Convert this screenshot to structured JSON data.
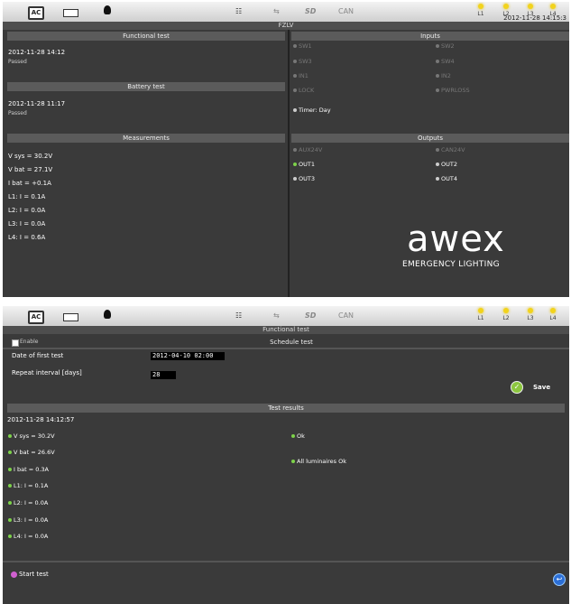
{
  "status": {
    "ac": "AC",
    "can": "CAN",
    "lamps": [
      "L1",
      "L2",
      "L3",
      "L4"
    ]
  },
  "screen1": {
    "title": "FZLV",
    "datetime": "2012-11-28 14:15:3",
    "functional_header": "Functional test",
    "functional_date": "2012-11-28 14:12",
    "functional_result": "Passed",
    "battery_header": "Battery test",
    "battery_date": "2012-11-28 11:17",
    "battery_result": "Passed",
    "meas_header": "Measurements",
    "measurements": [
      "V sys = 30.2V",
      "V bat = 27.1V",
      "I bat = +0.1A",
      "L1: I = 0.1A",
      "L2: I = 0.0A",
      "L3: I = 0.0A",
      "L4: I = 0.6A"
    ],
    "inputs_header": "Inputs",
    "inputs": [
      "SW1",
      "SW2",
      "SW3",
      "SW4",
      "IN1",
      "IN2",
      "LOCK",
      "PWRLOSS"
    ],
    "timer": "Timer: Day",
    "outputs_header": "Outputs",
    "outputs": [
      "AUX24V",
      "CAN24V",
      "OUT1",
      "OUT2",
      "OUT3",
      "OUT4"
    ],
    "logo": "awex",
    "logo_sub": "EMERGENCY LIGHTING"
  },
  "screen2": {
    "title": "Functional test",
    "enable": "Enable",
    "schedule_header": "Schedule test",
    "first_label": "Date of first test",
    "first_value": "2012-04-10 02:00",
    "repeat_label": "Repeat interval [days]",
    "repeat_value": "28",
    "save": "Save",
    "results_header": "Test results",
    "results_date": "2012-11-28 14:12:57",
    "results": [
      "V sys = 30.2V",
      "V bat = 26.6V",
      "I bat = 0.3A",
      "L1: I = 0.1A",
      "L2: I = 0.0A",
      "L3: I = 0.0A",
      "L4: I = 0.0A"
    ],
    "ok": "Ok",
    "all_ok": "All luminaires Ok",
    "start": "Start test"
  }
}
